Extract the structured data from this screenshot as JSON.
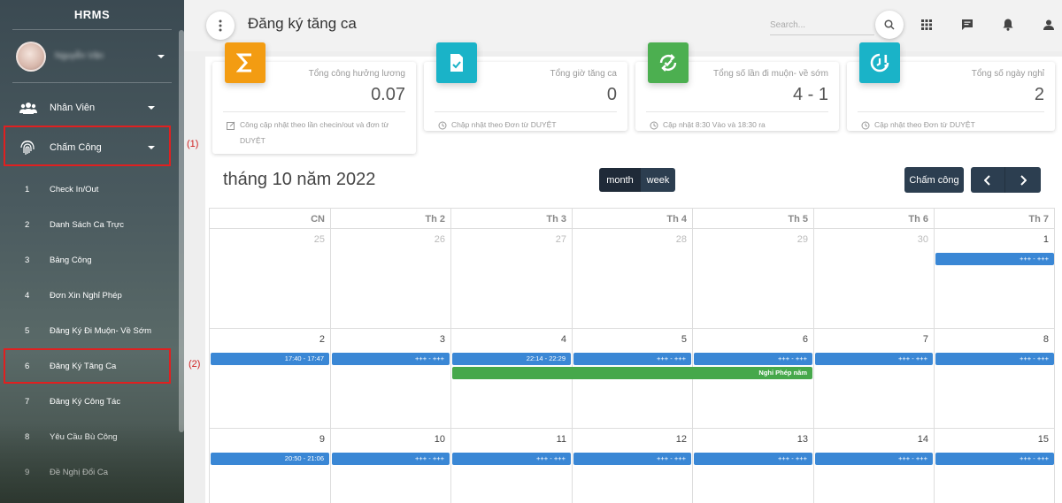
{
  "sidebar": {
    "brand": "HRMS",
    "user_name": "Nguyễn Văn",
    "menu": [
      {
        "label": "Nhân Viên"
      },
      {
        "label": "Chấm Công"
      }
    ],
    "sub_items": [
      {
        "num": "1",
        "label": "Check In/Out"
      },
      {
        "num": "2",
        "label": "Danh Sách Ca Trực"
      },
      {
        "num": "3",
        "label": "Bảng Công"
      },
      {
        "num": "4",
        "label": "Đơn Xin Nghỉ Phép"
      },
      {
        "num": "5",
        "label": "Đăng Ký Đi Muộn- Về Sớm"
      },
      {
        "num": "6",
        "label": "Đăng Ký Tăng Ca"
      },
      {
        "num": "7",
        "label": "Đăng Ký Công Tác"
      },
      {
        "num": "8",
        "label": "Yêu Cầu Bù Công"
      },
      {
        "num": "9",
        "label": "Đề Nghị Đổi Ca"
      }
    ]
  },
  "annotations": [
    "(1)",
    "(2)"
  ],
  "header": {
    "title": "Đăng ký tăng ca",
    "search_placeholder": "Search..."
  },
  "stats": [
    {
      "title": "Tổng công hưởng lương",
      "value": "0.07",
      "footer_line1": "Công cập nhật theo lần checin/out và đơn từ",
      "footer_line2": "DUYỆT",
      "color": "#f39c12",
      "icon": "sigma-icon"
    },
    {
      "title": "Tổng giờ tăng ca",
      "value": "0",
      "footer_line1": "Chập nhật theo Đơn từ DUYỆT",
      "footer_line2": "",
      "color": "#1ab3c8",
      "icon": "document-check-icon"
    },
    {
      "title": "Tổng số lần đi muộn- về sớm",
      "value": "4 - 1",
      "footer_line1": "Cập nhật 8:30 Vào và 18:30 ra",
      "footer_line2": "",
      "color": "#4caf50",
      "icon": "refresh-check-icon"
    },
    {
      "title": "Tổng số ngày nghỉ",
      "value": "2",
      "footer_line1": "Cập nhật theo Đơn từ DUYỆT",
      "footer_line2": "",
      "color": "#1ab3c8",
      "icon": "clock-alert-icon"
    }
  ],
  "calendar": {
    "title": "tháng 10 năm 2022",
    "view_month": "month",
    "view_week": "week",
    "cham_cong_label": "Chấm công",
    "weekdays": [
      "CN",
      "Th 2",
      "Th 3",
      "Th 4",
      "Th 5",
      "Th 6",
      "Th 7"
    ],
    "weeks": [
      {
        "days": [
          {
            "d": "25",
            "other": true
          },
          {
            "d": "26",
            "other": true
          },
          {
            "d": "27",
            "other": true
          },
          {
            "d": "28",
            "other": true
          },
          {
            "d": "29",
            "other": true
          },
          {
            "d": "30",
            "other": true
          },
          {
            "d": "1",
            "other": false
          }
        ],
        "events": [
          {
            "col": 6,
            "span": 1,
            "text": "+++ - +++",
            "color": "blue",
            "row": 0
          }
        ]
      },
      {
        "days": [
          {
            "d": "2"
          },
          {
            "d": "3"
          },
          {
            "d": "4"
          },
          {
            "d": "5"
          },
          {
            "d": "6"
          },
          {
            "d": "7"
          },
          {
            "d": "8"
          }
        ],
        "events": [
          {
            "col": 0,
            "span": 1,
            "text": "17:40 - 17:47",
            "color": "blue",
            "row": 0
          },
          {
            "col": 1,
            "span": 1,
            "text": "+++ - +++",
            "color": "blue",
            "row": 0
          },
          {
            "col": 2,
            "span": 1,
            "text": "22:14 - 22:29",
            "color": "blue",
            "row": 0
          },
          {
            "col": 3,
            "span": 1,
            "text": "+++ - +++",
            "color": "blue",
            "row": 0
          },
          {
            "col": 4,
            "span": 1,
            "text": "+++ - +++",
            "color": "blue",
            "row": 0
          },
          {
            "col": 5,
            "span": 1,
            "text": "+++ - +++",
            "color": "blue",
            "row": 0
          },
          {
            "col": 6,
            "span": 1,
            "text": "+++ - +++",
            "color": "blue",
            "row": 0
          },
          {
            "col": 2,
            "span": 3,
            "text": "Nghỉ Phép năm",
            "color": "green",
            "row": 1
          }
        ]
      },
      {
        "days": [
          {
            "d": "9"
          },
          {
            "d": "10"
          },
          {
            "d": "11"
          },
          {
            "d": "12"
          },
          {
            "d": "13"
          },
          {
            "d": "14"
          },
          {
            "d": "15"
          }
        ],
        "events": [
          {
            "col": 0,
            "span": 1,
            "text": "20:50 - 21:06",
            "color": "blue",
            "row": 0
          },
          {
            "col": 1,
            "span": 1,
            "text": "+++ - +++",
            "color": "blue",
            "row": 0
          },
          {
            "col": 2,
            "span": 1,
            "text": "+++ - +++",
            "color": "blue",
            "row": 0
          },
          {
            "col": 3,
            "span": 1,
            "text": "+++ - +++",
            "color": "blue",
            "row": 0
          },
          {
            "col": 4,
            "span": 1,
            "text": "+++ - +++",
            "color": "blue",
            "row": 0
          },
          {
            "col": 5,
            "span": 1,
            "text": "+++ - +++",
            "color": "blue",
            "row": 0
          },
          {
            "col": 6,
            "span": 1,
            "text": "+++ - +++",
            "color": "blue",
            "row": 0
          }
        ]
      }
    ]
  }
}
